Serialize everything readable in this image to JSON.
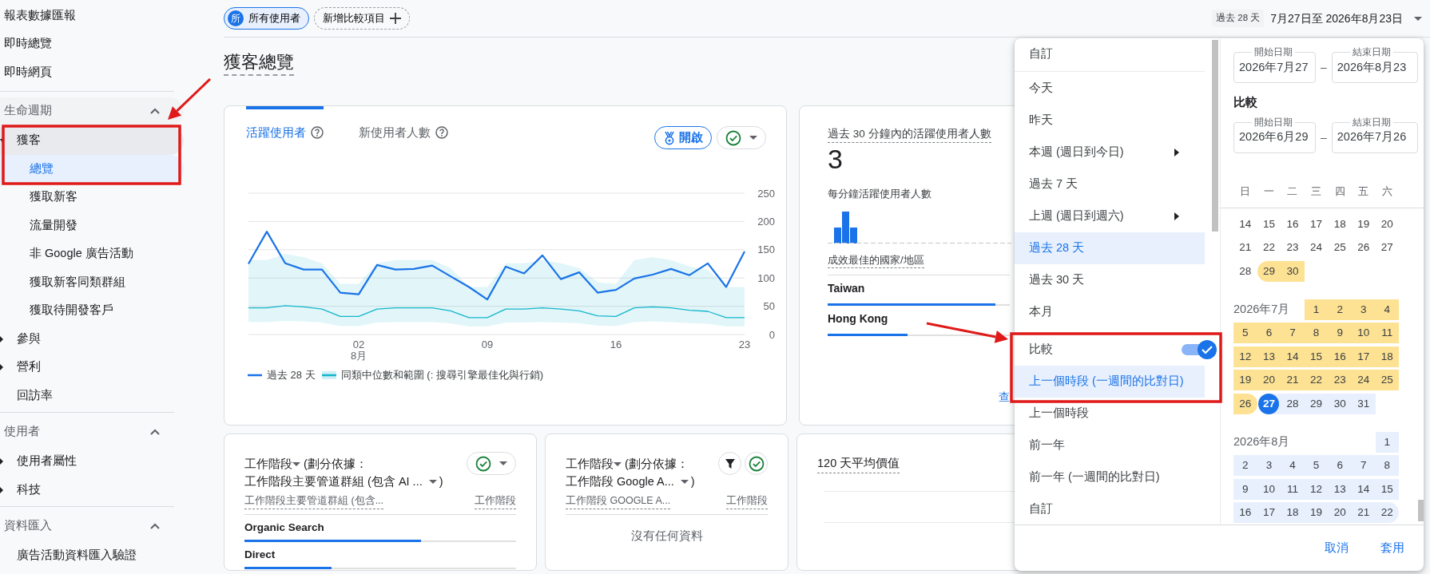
{
  "nav": {
    "links": [
      {
        "label": "報表數據匯報",
        "selected": false
      },
      {
        "label": "即時總覽",
        "selected": false
      },
      {
        "label": "即時網頁",
        "selected": false
      }
    ],
    "sections": [
      {
        "title": "生命週期",
        "expanded": true,
        "items": [
          {
            "label": "獲客",
            "expanded": true,
            "selected": false,
            "children": [
              {
                "label": "總覽",
                "selected": true
              },
              {
                "label": "獲取新客",
                "selected": false
              },
              {
                "label": "流量開發",
                "selected": false
              },
              {
                "label": "非 Google 廣告活動",
                "selected": false
              },
              {
                "label": "獲取新客同類群組",
                "selected": false
              },
              {
                "label": "獲取待開發客戶",
                "selected": false
              }
            ]
          },
          {
            "label": "參與",
            "expanded": false,
            "selected": false
          },
          {
            "label": "營利",
            "expanded": false,
            "selected": false
          },
          {
            "label": "回訪率",
            "selected": false
          }
        ]
      },
      {
        "title": "使用者",
        "expanded": true,
        "items": [
          {
            "label": "使用者屬性",
            "expanded": false,
            "selected": false
          },
          {
            "label": "科技",
            "expanded": false,
            "selected": false
          }
        ]
      },
      {
        "title": "資料匯入",
        "expanded": true,
        "items": [
          {
            "label": "廣告活動資料匯入驗證",
            "selected": false
          }
        ]
      }
    ]
  },
  "toolbar": {
    "segment": {
      "badge": "所",
      "label": "所有使用者"
    },
    "add_comparison": "新增比較項目",
    "date_range": {
      "preset": "過去 28 天",
      "text": "7月27日至 2026年8月23日"
    }
  },
  "page_title": "獲客總覽",
  "main_card": {
    "tabs": [
      {
        "label": "活躍使用者",
        "selected": true
      },
      {
        "label": "新使用者人數",
        "selected": false
      }
    ],
    "open_button": "開啟",
    "chart_data": {
      "type": "line",
      "grid": true,
      "x": [
        -4,
        -3,
        -2,
        -1,
        0,
        1,
        2,
        3,
        4,
        5,
        6,
        7,
        8,
        9,
        10,
        11,
        12,
        13,
        14,
        15,
        16,
        17,
        18,
        19,
        20,
        21,
        22,
        23
      ],
      "xlim": [
        -4,
        23
      ],
      "series": [
        {
          "name": "過去 28 天",
          "color": "#1a73e8",
          "values": [
            125,
            182,
            126,
            115,
            115,
            74,
            71,
            123,
            115,
            116,
            122,
            103,
            84,
            62,
            120,
            108,
            140,
            98,
            110,
            74,
            79,
            99,
            106,
            116,
            105,
            126,
            84,
            147
          ]
        },
        {
          "name": "同類中位數和範圍 (: 搜尋引擎最佳化與行銷)",
          "color": "#12b5cb",
          "values": [
            47,
            47,
            51,
            49,
            45,
            32,
            32,
            45,
            47,
            47,
            47,
            42,
            30,
            30,
            45,
            45,
            47,
            45,
            42,
            33,
            32,
            47,
            49,
            47,
            43,
            41,
            30,
            30
          ]
        }
      ],
      "ylim": [
        0,
        250
      ],
      "yticks": [
        0,
        50,
        100,
        150,
        200,
        250
      ],
      "xticks": [
        {
          "value": 2,
          "label": "02\n8月"
        },
        {
          "value": 9,
          "label": "09"
        },
        {
          "value": 16,
          "label": "16"
        },
        {
          "value": 23,
          "label": "23"
        }
      ]
    }
  },
  "realtime_card": {
    "title": "過去 30 分鐘內的活躍使用者人數",
    "value": "3",
    "subtitle": "每分鐘活躍使用者人數",
    "table_title": "成效最佳的國家/地區",
    "rows": [
      {
        "label": "Taiwan",
        "level": 0.92
      },
      {
        "label": "Hong Kong",
        "level": 0.44
      }
    ],
    "link": "查"
  },
  "session_cards": [
    {
      "metric": "工作階段",
      "by": "(劃分依據：",
      "dimension": "工作階段主要管道群組 (包含 AI ...",
      "close": ")",
      "filter": false,
      "columns": [
        "工作階段主要管道群組 (包含...",
        "工作階段"
      ],
      "rows": [
        {
          "label": "Organic Search",
          "level": 0.65
        },
        {
          "label": "Direct",
          "level": 0.32
        }
      ]
    },
    {
      "metric": "工作階段",
      "by": "(劃分依據：",
      "dimension": "工作階段 Google A...",
      "close": ")",
      "filter": true,
      "columns": [
        "工作階段 GOOGLE A...",
        "工作階段"
      ],
      "empty": "沒有任何資料"
    }
  ],
  "value_card": {
    "title": "120 天平均價值"
  },
  "date_menu": {
    "preset_groups": [
      [
        {
          "label": "自訂",
          "kind": "option",
          "selected": false
        }
      ],
      [
        {
          "label": "今天",
          "kind": "option",
          "selected": false
        },
        {
          "label": "昨天",
          "kind": "option",
          "selected": false
        },
        {
          "label": "本週 (週日到今日)",
          "kind": "submenu",
          "selected": false
        },
        {
          "label": "過去 7 天",
          "kind": "option",
          "selected": false
        },
        {
          "label": "上週 (週日到週六)",
          "kind": "submenu",
          "selected": false
        },
        {
          "label": "過去 28 天",
          "kind": "option",
          "selected": true
        },
        {
          "label": "過去 30 天",
          "kind": "option",
          "selected": false
        },
        {
          "label": "本月",
          "kind": "option",
          "selected": false
        }
      ]
    ],
    "compare": {
      "label": "比較",
      "on": true
    },
    "compare_presets": [
      {
        "label": "上一個時段 (一週間的比對日)",
        "kind": "option",
        "selected": true
      },
      {
        "label": "上一個時段",
        "kind": "option",
        "selected": false
      },
      {
        "label": "前一年",
        "kind": "option",
        "selected": false
      },
      {
        "label": "前一年 (一週間的比對日)",
        "kind": "option",
        "selected": false
      },
      {
        "label": "自訂",
        "kind": "option",
        "selected": false
      }
    ],
    "range_fields": [
      {
        "label": "開始日期",
        "value": "2026年7月27"
      },
      {
        "label": "結束日期",
        "value": "2026年8月23"
      }
    ],
    "range_separator": "–",
    "compare_title": "比較",
    "compare_fields": [
      {
        "label": "開始日期",
        "value": "2026年6月29"
      },
      {
        "label": "結束日期",
        "value": "2026年7月26"
      }
    ],
    "compare_separator": "–",
    "weekdays": [
      "日",
      "一",
      "二",
      "三",
      "四",
      "五",
      "六"
    ],
    "months": [
      {
        "weeks": [
          [
            {
              "day": "14",
              "in_compare": false,
              "in_range": false,
              "selected": false
            },
            {
              "day": "15",
              "in_compare": false,
              "in_range": false,
              "selected": false
            },
            {
              "day": "16",
              "in_compare": false,
              "in_range": false,
              "selected": false
            },
            {
              "day": "17",
              "in_compare": false,
              "in_range": false,
              "selected": false
            },
            {
              "day": "18",
              "in_compare": false,
              "in_range": false,
              "selected": false
            },
            {
              "day": "19",
              "in_compare": false,
              "in_range": false,
              "selected": false
            },
            {
              "day": "20",
              "in_compare": false,
              "in_range": false,
              "selected": false
            }
          ],
          [
            {
              "day": "21",
              "in_compare": false,
              "in_range": false,
              "selected": false
            },
            {
              "day": "22",
              "in_compare": false,
              "in_range": false,
              "selected": false
            },
            {
              "day": "23",
              "in_compare": false,
              "in_range": false,
              "selected": false
            },
            {
              "day": "24",
              "in_compare": false,
              "in_range": false,
              "selected": false
            },
            {
              "day": "25",
              "in_compare": false,
              "in_range": false,
              "selected": false
            },
            {
              "day": "26",
              "in_compare": false,
              "in_range": false,
              "selected": false
            },
            {
              "day": "27",
              "in_compare": false,
              "in_range": false,
              "selected": false
            }
          ],
          [
            {
              "day": "28",
              "in_compare": false,
              "in_range": false,
              "selected": false
            },
            {
              "day": "29",
              "in_compare": true,
              "in_range": false,
              "selected": false
            },
            {
              "day": "30",
              "in_compare": true,
              "in_range": false,
              "selected": false
            }
          ]
        ]
      },
      {
        "label": "2026年7月",
        "weeks": [
          [
            {
              "day": "1",
              "in_compare": true,
              "in_range": false,
              "selected": false
            },
            {
              "day": "2",
              "in_compare": true,
              "in_range": false,
              "selected": false
            },
            {
              "day": "3",
              "in_compare": true,
              "in_range": false,
              "selected": false
            },
            {
              "day": "4",
              "in_compare": true,
              "in_range": false,
              "selected": false
            }
          ],
          [
            {
              "day": "5",
              "in_compare": true,
              "in_range": false,
              "selected": false
            },
            {
              "day": "6",
              "in_compare": true,
              "in_range": false,
              "selected": false
            },
            {
              "day": "7",
              "in_compare": true,
              "in_range": false,
              "selected": false
            },
            {
              "day": "8",
              "in_compare": true,
              "in_range": false,
              "selected": false
            },
            {
              "day": "9",
              "in_compare": true,
              "in_range": false,
              "selected": false
            },
            {
              "day": "10",
              "in_compare": true,
              "in_range": false,
              "selected": false
            },
            {
              "day": "11",
              "in_compare": true,
              "in_range": false,
              "selected": false
            }
          ],
          [
            {
              "day": "12",
              "in_compare": true,
              "in_range": false,
              "selected": false
            },
            {
              "day": "13",
              "in_compare": true,
              "in_range": false,
              "selected": false
            },
            {
              "day": "14",
              "in_compare": true,
              "in_range": false,
              "selected": false
            },
            {
              "day": "15",
              "in_compare": true,
              "in_range": false,
              "selected": false
            },
            {
              "day": "16",
              "in_compare": true,
              "in_range": false,
              "selected": false
            },
            {
              "day": "17",
              "in_compare": true,
              "in_range": false,
              "selected": false
            },
            {
              "day": "18",
              "in_compare": true,
              "in_range": false,
              "selected": false
            }
          ],
          [
            {
              "day": "19",
              "in_compare": true,
              "in_range": false,
              "selected": false
            },
            {
              "day": "20",
              "in_compare": true,
              "in_range": false,
              "selected": false
            },
            {
              "day": "21",
              "in_compare": true,
              "in_range": false,
              "selected": false
            },
            {
              "day": "22",
              "in_compare": true,
              "in_range": false,
              "selected": false
            },
            {
              "day": "23",
              "in_compare": true,
              "in_range": false,
              "selected": false
            },
            {
              "day": "24",
              "in_compare": true,
              "in_range": false,
              "selected": false
            },
            {
              "day": "25",
              "in_compare": true,
              "in_range": false,
              "selected": false
            }
          ],
          [
            {
              "day": "26",
              "in_compare": true,
              "in_range": false,
              "selected": false
            },
            {
              "day": "27",
              "in_compare": false,
              "in_range": true,
              "selected": true
            },
            {
              "day": "28",
              "in_compare": false,
              "in_range": true,
              "selected": false
            },
            {
              "day": "29",
              "in_compare": false,
              "in_range": true,
              "selected": false
            },
            {
              "day": "30",
              "in_compare": false,
              "in_range": true,
              "selected": false
            },
            {
              "day": "31",
              "in_compare": false,
              "in_range": true,
              "selected": false
            }
          ]
        ]
      },
      {
        "label": "2026年8月",
        "weeks": [
          [
            {
              "day": "1",
              "in_compare": false,
              "in_range": true,
              "selected": false
            }
          ],
          [
            {
              "day": "2",
              "in_compare": false,
              "in_range": true,
              "selected": false
            },
            {
              "day": "3",
              "in_compare": false,
              "in_range": true,
              "selected": false
            },
            {
              "day": "4",
              "in_compare": false,
              "in_range": true,
              "selected": false
            },
            {
              "day": "5",
              "in_compare": false,
              "in_range": true,
              "selected": false
            },
            {
              "day": "6",
              "in_compare": false,
              "in_range": true,
              "selected": false
            },
            {
              "day": "7",
              "in_compare": false,
              "in_range": true,
              "selected": false
            },
            {
              "day": "8",
              "in_compare": false,
              "in_range": true,
              "selected": false
            }
          ],
          [
            {
              "day": "9",
              "in_compare": false,
              "in_range": true,
              "selected": false
            },
            {
              "day": "10",
              "in_compare": false,
              "in_range": true,
              "selected": false
            },
            {
              "day": "11",
              "in_compare": false,
              "in_range": true,
              "selected": false
            },
            {
              "day": "12",
              "in_compare": false,
              "in_range": true,
              "selected": false
            },
            {
              "day": "13",
              "in_compare": false,
              "in_range": true,
              "selected": false
            },
            {
              "day": "14",
              "in_compare": false,
              "in_range": true,
              "selected": false
            },
            {
              "day": "15",
              "in_compare": false,
              "in_range": true,
              "selected": false
            }
          ],
          [
            {
              "day": "16",
              "in_compare": false,
              "in_range": true,
              "selected": false
            },
            {
              "day": "17",
              "in_compare": false,
              "in_range": true,
              "selected": false
            },
            {
              "day": "18",
              "in_compare": false,
              "in_range": true,
              "selected": false
            },
            {
              "day": "19",
              "in_compare": false,
              "in_range": true,
              "selected": false
            },
            {
              "day": "20",
              "in_compare": false,
              "in_range": true,
              "selected": false
            },
            {
              "day": "21",
              "in_compare": false,
              "in_range": true,
              "selected": false
            },
            {
              "day": "22",
              "in_compare": false,
              "in_range": true,
              "selected": false
            }
          ]
        ]
      }
    ],
    "buttons": [
      "取消",
      "套用"
    ]
  }
}
